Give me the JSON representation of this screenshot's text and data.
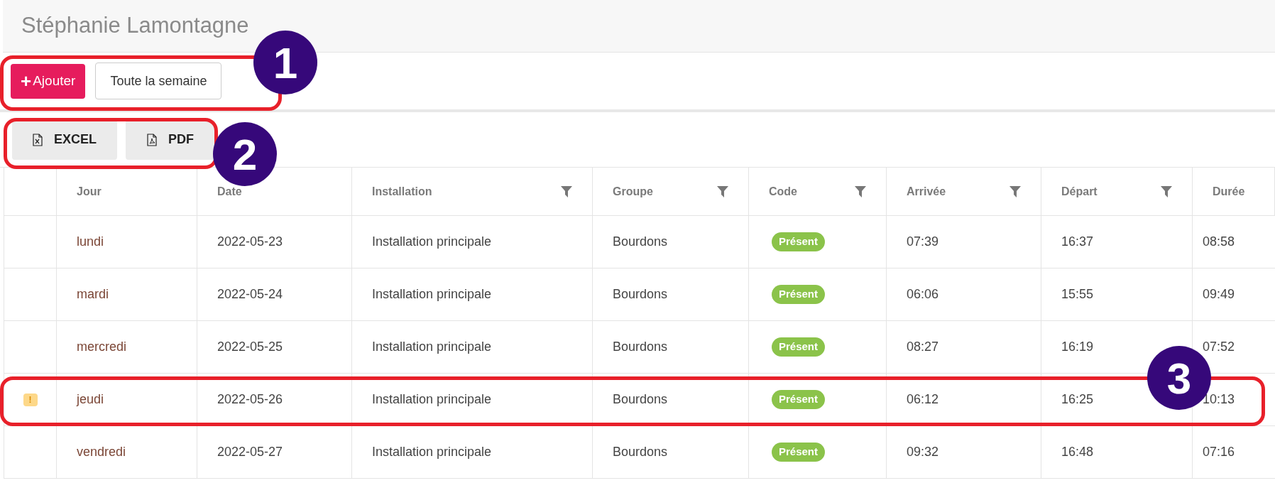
{
  "page_title": "Stéphanie Lamontagne",
  "toolbar": {
    "add_button": {
      "icon": "+",
      "label": "Ajouter"
    },
    "week_button": {
      "label": "Toute la semaine"
    }
  },
  "export_buttons": [
    {
      "kind": "excel",
      "label": "EXCEL"
    },
    {
      "kind": "pdf",
      "label": "PDF"
    }
  ],
  "table": {
    "columns": [
      {
        "filter": false
      },
      {
        "label": "Jour",
        "filter": false
      },
      {
        "label": "Date",
        "filter": false
      },
      {
        "label": "Installation",
        "filter": true
      },
      {
        "label": "Groupe",
        "filter": true
      },
      {
        "label": "Code",
        "filter": true
      },
      {
        "label": "Arrivée",
        "filter": true
      },
      {
        "label": "Départ",
        "filter": true
      },
      {
        "label": "Durée",
        "filter": false
      }
    ],
    "rows": [
      {
        "warning": false,
        "day": "lundi",
        "date": "2022-05-23",
        "installation": "Installation principale",
        "group": "Bourdons",
        "code": "Présent",
        "arrival": "07:39",
        "departure": "16:37",
        "duration": "08:58"
      },
      {
        "warning": false,
        "day": "mardi",
        "date": "2022-05-24",
        "installation": "Installation principale",
        "group": "Bourdons",
        "code": "Présent",
        "arrival": "06:06",
        "departure": "15:55",
        "duration": "09:49"
      },
      {
        "warning": false,
        "day": "mercredi",
        "date": "2022-05-25",
        "installation": "Installation principale",
        "group": "Bourdons",
        "code": "Présent",
        "arrival": "08:27",
        "departure": "16:19",
        "duration": "07:52"
      },
      {
        "warning": true,
        "warning_mark": "!",
        "day": "jeudi",
        "date": "2022-05-26",
        "installation": "Installation principale",
        "group": "Bourdons",
        "code": "Présent",
        "arrival": "06:12",
        "departure": "16:25",
        "duration": "10:13"
      },
      {
        "warning": false,
        "day": "vendredi",
        "date": "2022-05-27",
        "installation": "Installation principale",
        "group": "Bourdons",
        "code": "Présent",
        "arrival": "09:32",
        "departure": "16:48",
        "duration": "07:16"
      }
    ]
  },
  "annotations": [
    {
      "number": "1",
      "kind": "toolbar"
    },
    {
      "number": "2",
      "kind": "export"
    },
    {
      "number": "3",
      "kind": "row"
    }
  ]
}
